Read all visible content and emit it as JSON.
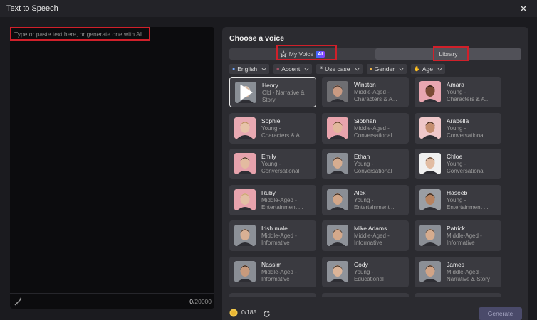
{
  "window": {
    "title": "Text to Speech"
  },
  "editor": {
    "placeholder": "Type or paste text here, or generate one with AI.",
    "char_current": "0",
    "char_max": "/20000"
  },
  "voice_panel": {
    "title": "Choose a voice",
    "tabs": {
      "my_voice": "My Voice",
      "ai_badge": "AI",
      "library": "Library"
    },
    "filters": [
      {
        "label": "English",
        "icon": "globe-icon"
      },
      {
        "label": "Accent",
        "icon": "accent-icon"
      },
      {
        "label": "Use case",
        "icon": "quote-icon"
      },
      {
        "label": "Gender",
        "icon": "gender-icon"
      },
      {
        "label": "Age",
        "icon": "age-icon"
      }
    ],
    "voices": [
      {
        "name": "Henry",
        "desc1": "Old - Narrative &",
        "desc2": "Story",
        "bg": "#8a8f96",
        "skin": "#d9b8a0",
        "hair": "#cfcfcf"
      },
      {
        "name": "Winston",
        "desc1": "Middle-Aged -",
        "desc2": "Characters & A...",
        "bg": "#6e6e72",
        "skin": "#c99a82",
        "hair": "#3a2e28"
      },
      {
        "name": "Amara",
        "desc1": "Young -",
        "desc2": "Characters & A...",
        "bg": "#e9a6b0",
        "skin": "#7a4a34",
        "hair": "#1e1410"
      },
      {
        "name": "Sophie",
        "desc1": "Young -",
        "desc2": "Characters & A...",
        "bg": "#e8a9b2",
        "skin": "#e7c3a9",
        "hair": "#b98a5a"
      },
      {
        "name": "Siobhán",
        "desc1": "Middle-Aged -",
        "desc2": "Conversational",
        "bg": "#e9a4ad",
        "skin": "#e2b89c",
        "hair": "#5a3a24"
      },
      {
        "name": "Arabella",
        "desc1": "Young -",
        "desc2": "Conversational",
        "bg": "#efc7c9",
        "skin": "#c48e70",
        "hair": "#2a1a14"
      },
      {
        "name": "Emily",
        "desc1": "Young -",
        "desc2": "Conversational",
        "bg": "#e6a2ac",
        "skin": "#e3bba0",
        "hair": "#3a2a20"
      },
      {
        "name": "Ethan",
        "desc1": "Young -",
        "desc2": "Conversational",
        "bg": "#8b8f96",
        "skin": "#d6ad90",
        "hair": "#3b2a20"
      },
      {
        "name": "Chloe",
        "desc1": "Young -",
        "desc2": "Conversational",
        "bg": "#f0f0f0",
        "skin": "#e2bca2",
        "hair": "#4a3224"
      },
      {
        "name": "Ruby",
        "desc1": "Middle-Aged -",
        "desc2": "Entertainment ...",
        "bg": "#e8a3ad",
        "skin": "#e3bfa4",
        "hair": "#c9a46c"
      },
      {
        "name": "Alex",
        "desc1": "Young -",
        "desc2": "Entertainment ...",
        "bg": "#8a8e95",
        "skin": "#d2a688",
        "hair": "#2a1e18"
      },
      {
        "name": "Haseeb",
        "desc1": "Young -",
        "desc2": "Entertainment ...",
        "bg": "#9a9ea4",
        "skin": "#b7825f",
        "hair": "#1a1410"
      },
      {
        "name": "Irish male",
        "desc1": "Middle-Aged -",
        "desc2": "Informative",
        "bg": "#8c9097",
        "skin": "#d8b094",
        "hair": "#3a2c22"
      },
      {
        "name": "Mike Adams",
        "desc1": "Middle-Aged -",
        "desc2": "Informative",
        "bg": "#8d9198",
        "skin": "#d4a98b",
        "hair": "#2e241c"
      },
      {
        "name": "Patrick",
        "desc1": "Middle-Aged -",
        "desc2": "Informative",
        "bg": "#8b8f96",
        "skin": "#d6ac8e",
        "hair": "#4a3a2e"
      },
      {
        "name": "Nassim",
        "desc1": "Middle-Aged -",
        "desc2": "Informative",
        "bg": "#8a8e95",
        "skin": "#c89a7c",
        "hair": "#241a14"
      },
      {
        "name": "Cody",
        "desc1": "Young -",
        "desc2": "Educational",
        "bg": "#8f939a",
        "skin": "#dcb498",
        "hair": "#3a2a1e"
      },
      {
        "name": "James",
        "desc1": "Middle-Aged -",
        "desc2": "Narrative & Story",
        "bg": "#8b8f96",
        "skin": "#d2a486",
        "hair": "#2a201a"
      }
    ]
  },
  "footer": {
    "credits": "0/185",
    "generate_label": "Generate"
  },
  "colors": {
    "highlight": "#d0202a",
    "ai_badge": "#3a6cff"
  }
}
